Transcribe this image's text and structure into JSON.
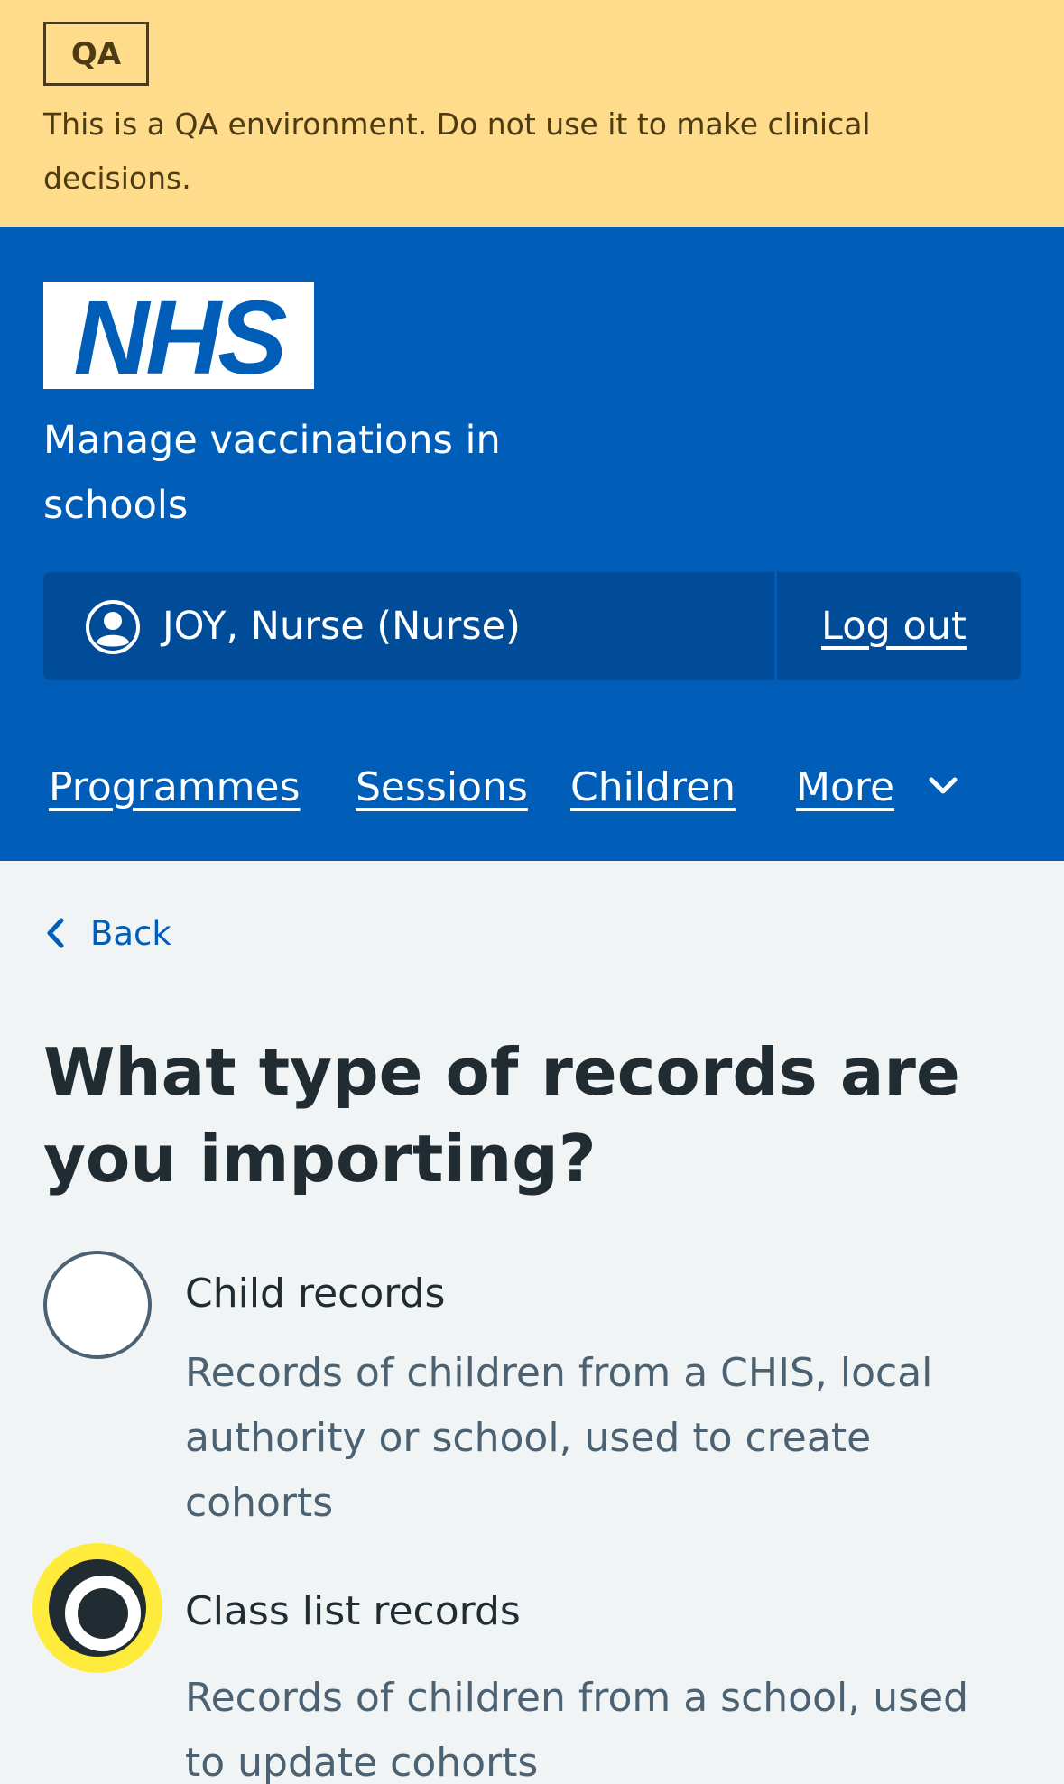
{
  "qa_banner": {
    "tag": "QA",
    "message": "This is a QA environment. Do not use it to make clinical decisions."
  },
  "header": {
    "logo_text": "NHS",
    "service_name": "Manage vaccinations in schools",
    "account": {
      "user": "JOY, Nurse (Nurse)",
      "logout_label": "Log out"
    },
    "nav": {
      "items": [
        "Programmes",
        "Sessions",
        "Children",
        "More"
      ]
    }
  },
  "back_link": "Back",
  "page_title": "What type of records are you importing?",
  "options": [
    {
      "label": "Child records",
      "hint": "Records of children from a CHIS, local authority or school, used to create cohorts",
      "selected": false
    },
    {
      "label": "Class list records",
      "hint": "Records of children from a school, used to update cohorts",
      "selected": true
    }
  ],
  "colors": {
    "nhs_blue": "#005eb8",
    "qa_yellow": "#ffdb8c",
    "focus_yellow": "#ffeb3b",
    "text": "#212b32",
    "secondary_text": "#4c6272",
    "page_bg": "#f0f4f5"
  },
  "icons": [
    "user-icon",
    "chevron-down-icon",
    "chevron-left-icon"
  ]
}
